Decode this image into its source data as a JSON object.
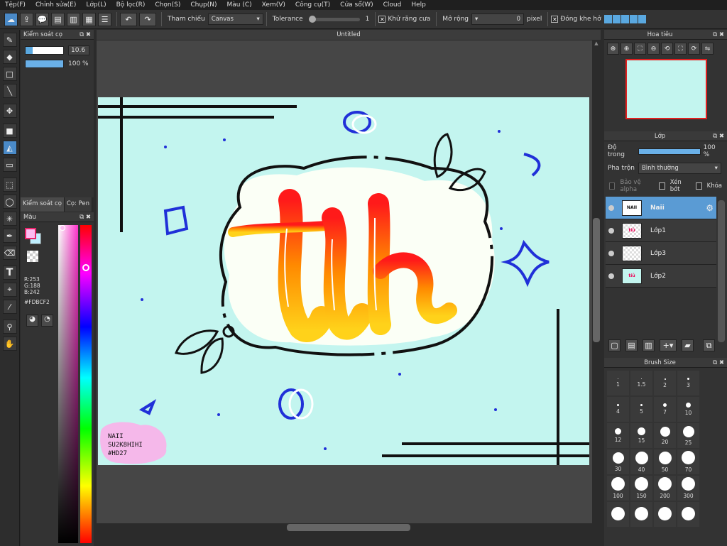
{
  "menu": [
    "Tệp(F)",
    "Chỉnh sửa(E)",
    "Lớp(L)",
    "Bộ lọc(R)",
    "Chọn(S)",
    "Chụp(N)",
    "Màu (C)",
    "Xem(V)",
    "Công cụ(T)",
    "Cửa sổ(W)",
    "Cloud",
    "Help"
  ],
  "toolbar": {
    "reference_label": "Tham chiếu",
    "reference_value": "Canvas",
    "tolerance_label": "Tolerance",
    "tolerance_value": "1",
    "antialias_label": "Khử răng cưa",
    "expand_label": "Mở rộng",
    "expand_value": "0",
    "expand_unit": "pixel",
    "close_gap_label": "Đóng khe hở"
  },
  "brush_control": {
    "title": "Kiểm soát cọ",
    "size_value": "10.6",
    "opacity_value": "100 %"
  },
  "tabs": [
    "Kiểm soát cọ",
    "Cọ: Pen"
  ],
  "color_panel": {
    "title": "Màu",
    "r": "R:253",
    "g": "G:188",
    "b": "B:242",
    "hex": "#FDBCF2",
    "fg_color": "#fdbcf2"
  },
  "document": {
    "title": "Untitled",
    "art_word": "tíủ",
    "signature": [
      "NAII",
      "SU2K8HIHI",
      "#HD27"
    ],
    "canvas_bg": "#c3f5ef"
  },
  "navigator": {
    "title": "Hoa tiêu"
  },
  "layers": {
    "title": "Lớp",
    "opacity_label": "Độ trong",
    "opacity_value": "100 %",
    "blend_label": "Pha trộn",
    "blend_value": "Bình thường",
    "protect_alpha": "Bảo vệ alpha",
    "clip": "Xén bớt",
    "lock": "Khóa",
    "items": [
      {
        "name": "Naii",
        "selected": true
      },
      {
        "name": "Lớp1",
        "selected": false
      },
      {
        "name": "Lớp3",
        "selected": false
      },
      {
        "name": "Lớp2",
        "selected": false
      }
    ]
  },
  "brush_size": {
    "title": "Brush Size",
    "sizes": [
      "1",
      "1.5",
      "2",
      "3",
      "4",
      "5",
      "7",
      "10",
      "12",
      "15",
      "20",
      "25",
      "30",
      "40",
      "50",
      "70",
      "100",
      "150",
      "200",
      "300",
      "",
      "",
      "",
      ""
    ]
  }
}
